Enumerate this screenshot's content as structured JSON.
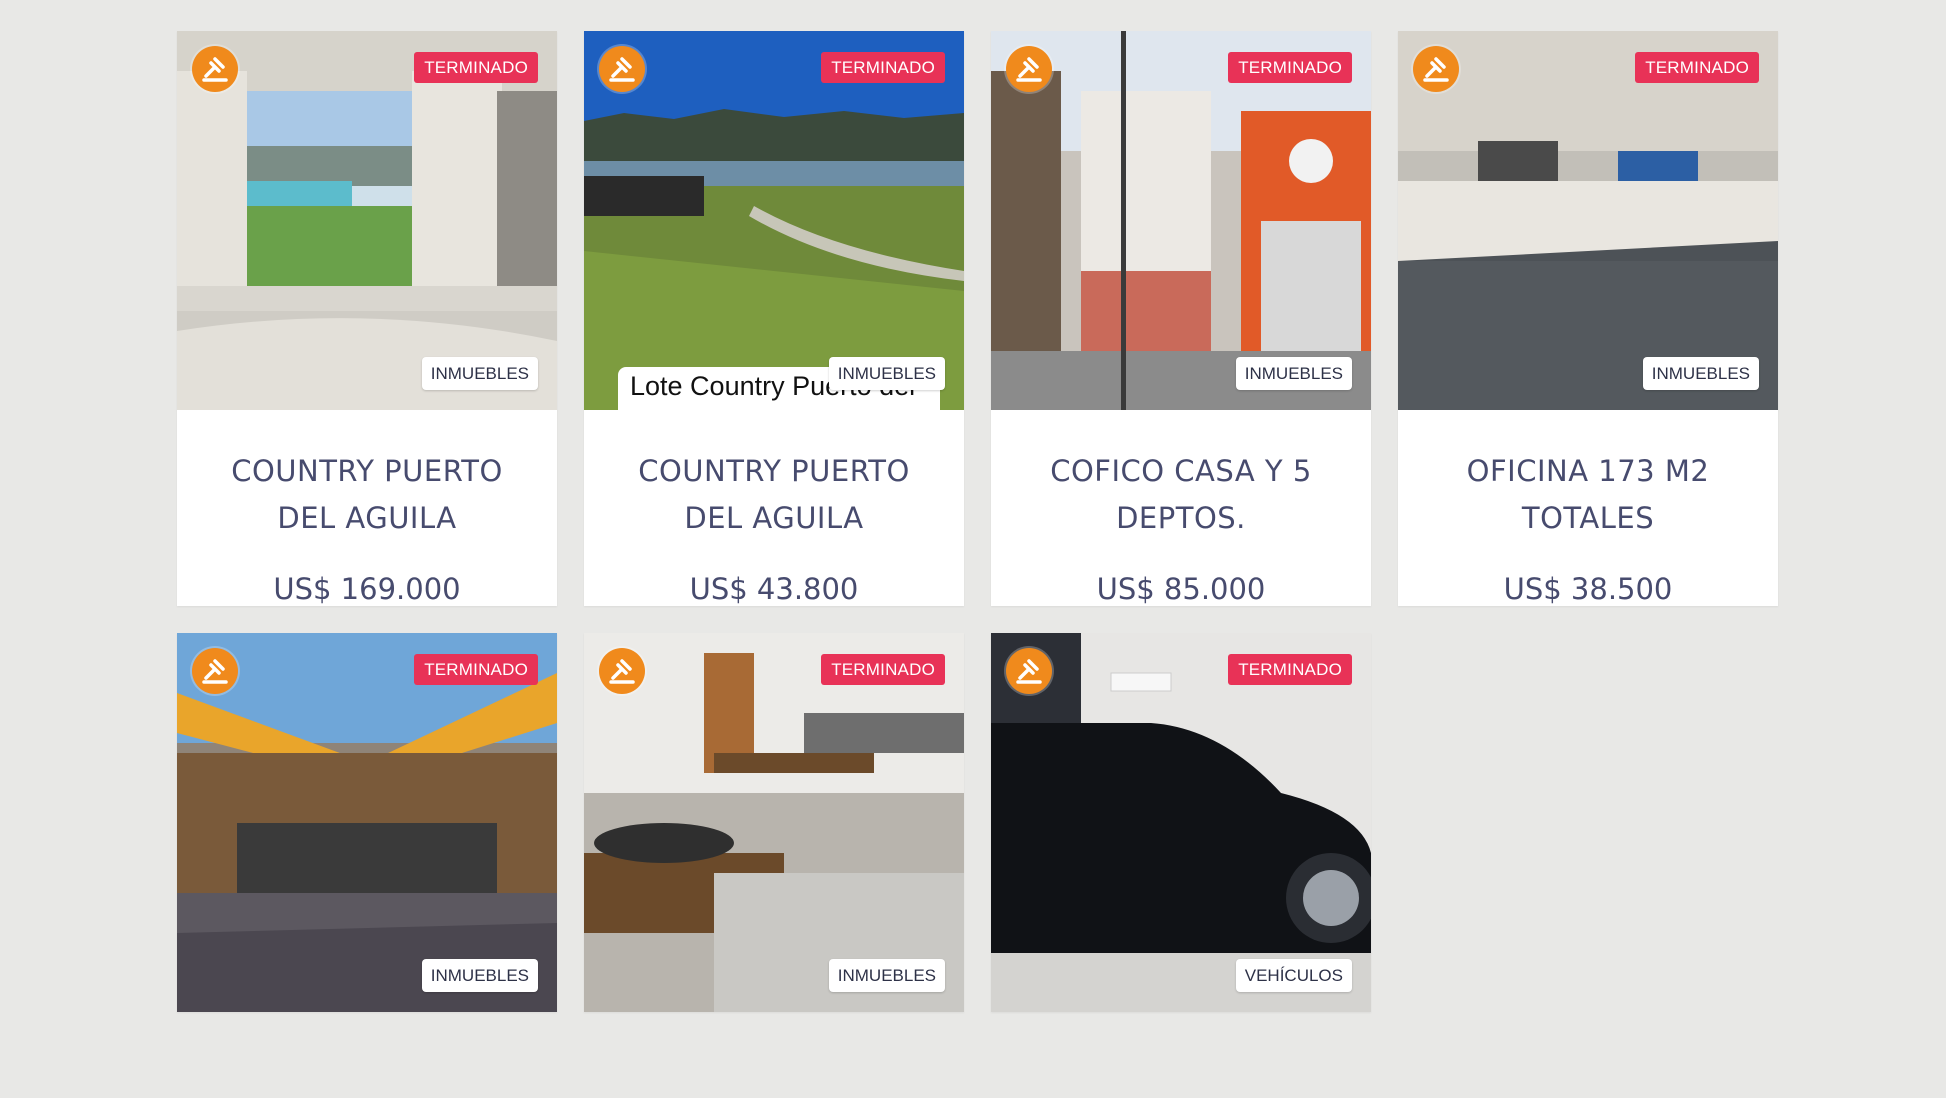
{
  "colors": {
    "background": "#e8e8e6",
    "status_badge": "#e83257",
    "logo": "#f08a1c",
    "text": "#474b6e"
  },
  "logo_icon": "auction-gavel-logo-icon",
  "listings": [
    {
      "status": "TERMINADO",
      "category": "INMUEBLES",
      "title_line1": "COUNTRY PUERTO",
      "title_line2": "DEL AGUILA",
      "price": "US$ 169.000"
    },
    {
      "status": "TERMINADO",
      "category": "INMUEBLES",
      "caption": "Lote Country Puerto del",
      "title_line1": "COUNTRY PUERTO",
      "title_line2": "DEL AGUILA",
      "price": "US$ 43.800"
    },
    {
      "status": "TERMINADO",
      "category": "INMUEBLES",
      "title_line1": "COFICO CASA Y 5",
      "title_line2": "DEPTOS.",
      "price": "US$ 85.000"
    },
    {
      "status": "TERMINADO",
      "category": "INMUEBLES",
      "title_line1": "OFICINA 173 M2",
      "title_line2": "TOTALES",
      "price": "US$ 38.500"
    },
    {
      "status": "TERMINADO",
      "category": "INMUEBLES"
    },
    {
      "status": "TERMINADO",
      "category": "INMUEBLES"
    },
    {
      "status": "TERMINADO",
      "category": "VEHÍCULOS"
    }
  ]
}
